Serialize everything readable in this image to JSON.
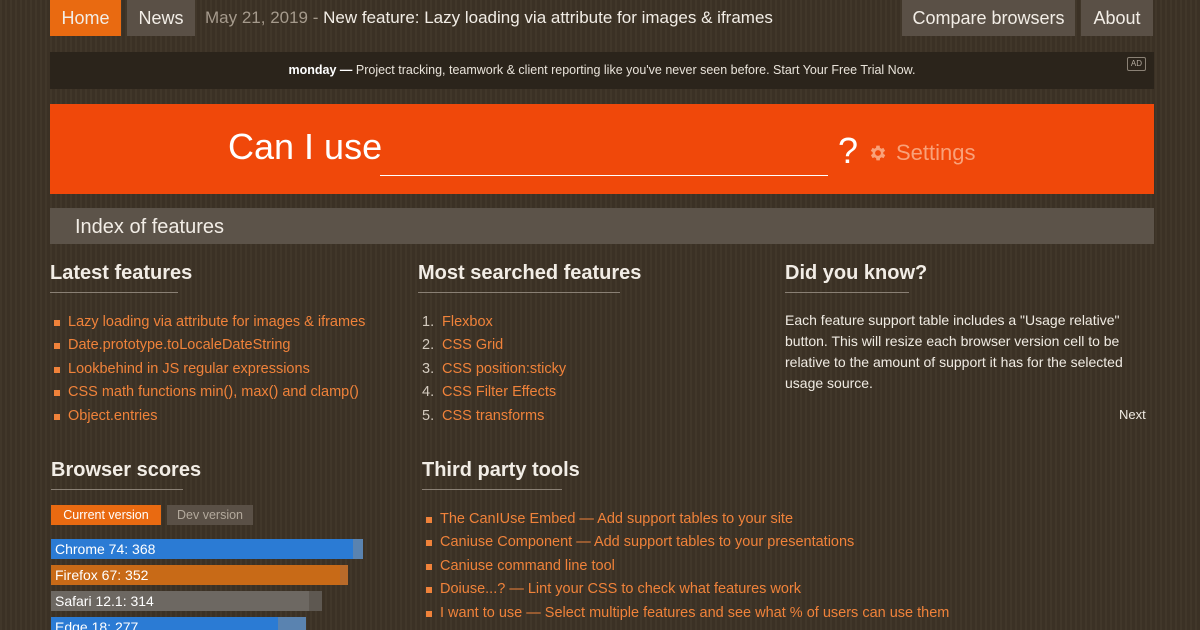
{
  "nav": {
    "home": "Home",
    "news": "News",
    "news_date": "May 21, 2019",
    "news_separator": " - ",
    "news_headline": "New feature: Lazy loading via attribute for images & iframes",
    "compare": "Compare browsers",
    "about": "About"
  },
  "ad": {
    "brand": "monday —",
    "text": " Project tracking, teamwork & client reporting like you've never seen before. Start Your Free Trial Now.",
    "badge": "AD"
  },
  "hero": {
    "label": "Can I use",
    "search_value": "",
    "question_mark": "?",
    "settings": "Settings"
  },
  "index": {
    "title": "Index of features"
  },
  "latest": {
    "title": "Latest features",
    "items": [
      "Lazy loading via attribute for images & iframes",
      "Date.prototype.toLocaleDateString",
      "Lookbehind in JS regular expressions",
      "CSS math functions min(), max() and clamp()",
      "Object.entries"
    ]
  },
  "searched": {
    "title": "Most searched features",
    "items": [
      {
        "num": "1.",
        "label": "Flexbox"
      },
      {
        "num": "2.",
        "label": "CSS Grid"
      },
      {
        "num": "3.",
        "label": "CSS position:sticky"
      },
      {
        "num": "4.",
        "label": "CSS Filter Effects"
      },
      {
        "num": "5.",
        "label": "CSS transforms"
      }
    ]
  },
  "did_you_know": {
    "title": "Did you know?",
    "text": "Each feature support table includes a \"Usage relative\" button. This will resize each browser version cell to be relative to the amount of support it has for the selected usage source.",
    "next": "Next"
  },
  "scores": {
    "title": "Browser scores",
    "tabs": {
      "current": "Current version",
      "dev": "Dev version"
    },
    "items": [
      {
        "label": "Chrome 74: 368",
        "current": 368,
        "dev": 380,
        "color": "#2b7bd4",
        "track": "#5a83b0"
      },
      {
        "label": "Firefox 67: 352",
        "current": 352,
        "dev": 362,
        "color": "#c86a17",
        "track": "#b86a2a"
      },
      {
        "label": "Safari 12.1: 314",
        "current": 314,
        "dev": 330,
        "color": "#6d6862",
        "track": "#5e5851"
      },
      {
        "label": "Edge 18: 277",
        "current": 277,
        "dev": 310,
        "color": "#2b7bd4",
        "track": "#5a83b0"
      }
    ],
    "max": 380
  },
  "tools": {
    "title": "Third party tools",
    "items": [
      "The CanIUse Embed — Add support tables to your site",
      "Caniuse Component — Add support tables to your presentations",
      "Caniuse command line tool",
      "Doiuse...? — Lint your CSS to check what features work",
      "I want to use — Select multiple features and see what % of users can use them"
    ]
  },
  "colors": {
    "accent": "#e96a11",
    "hero": "#f0480a",
    "link": "#f0823a",
    "background": "#3d3326"
  }
}
